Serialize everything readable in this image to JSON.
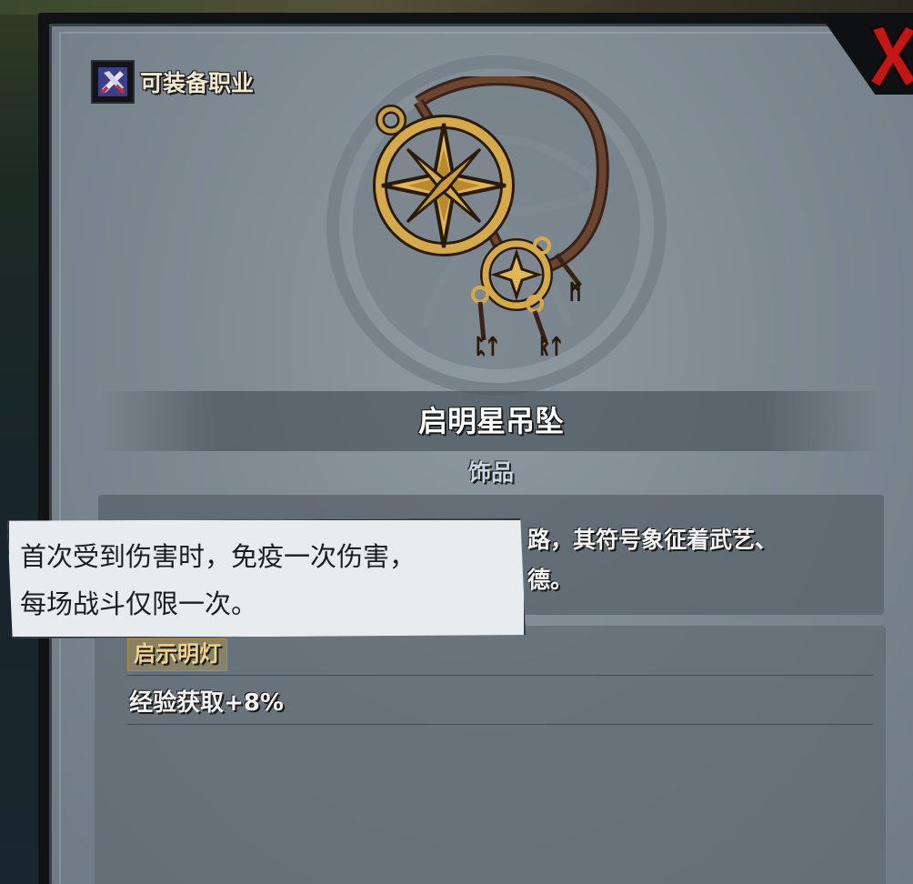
{
  "header": {
    "class_label": "可装备职业",
    "class_icon": "crossed-tools-icon"
  },
  "item": {
    "name": "启明星吊坠",
    "type": "饰品",
    "description_fragment": "路，其符号象征着武艺、\n德。",
    "trait_name": "启示明灯",
    "stat": "经验获取+8%"
  },
  "tooltip": {
    "text": "首次受到伤害时，免疫一次伤害，\n每场战斗仅限一次。"
  },
  "colors": {
    "panel": "#7f8a93",
    "close_red": "#c41616",
    "gold": "#c8a046"
  }
}
